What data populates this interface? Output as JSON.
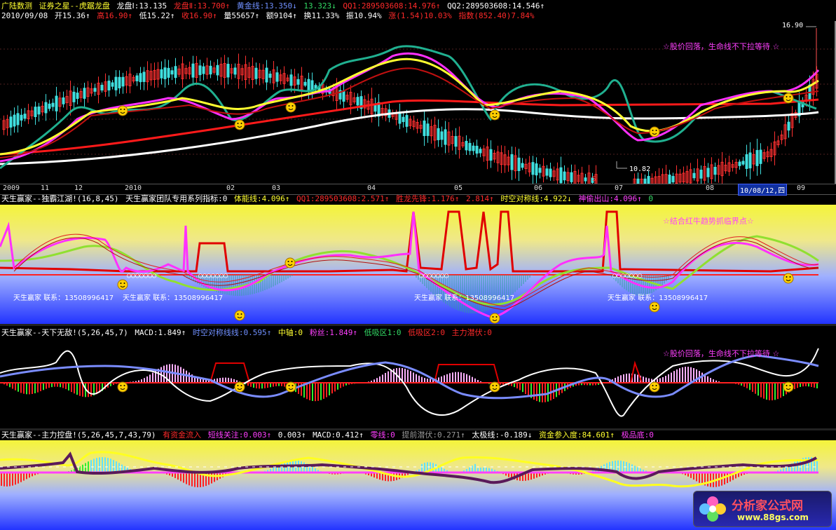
{
  "header1": [
    "广陆数测",
    "证券之星--虎踞龙盘",
    "龙盘Ⅰ:13.135",
    "龙盘Ⅱ:13.700↑",
    "黄金线:13.350↓",
    "13.323↓",
    "QQ1:289503608:14.976↑",
    "QQ2:289503608:14.546↑"
  ],
  "header2": [
    "2010/09/08",
    "开15.36↑",
    "高16.90↑",
    "低15.22↑",
    "收16.90↑",
    "量55657↑",
    "额9104↑",
    "换11.33%",
    "振10.94%",
    "涨(1.54)10.03%",
    "指数(852.40)7.84%"
  ],
  "main": {
    "high_label": "16.90",
    "low_label": "10.82",
    "s_mark": "S",
    "note": "☆股价回落，生命线不下拉等待 ☆"
  },
  "axis": {
    "labels": [
      "2009",
      "11",
      "12",
      "2010",
      "02",
      "03",
      "04",
      "05",
      "06",
      "07",
      "08",
      "09"
    ],
    "selected": "10/08/12,四"
  },
  "panel2": {
    "header": [
      "天生赢家--独霸江湖!(16,8,45)",
      "天生赢家团队专用系列指标:0",
      "体能线:4.096↑",
      "QQ1:289503608:2.571↑",
      "胜龙先锋:1.176↑",
      "2.814↑",
      "时空对称线:4.922↓",
      "神偷出山:4.096↑",
      "0"
    ],
    "note": "☆结合红牛趋势抓临界点☆",
    "contact_a": "天生赢家 联系：13508996417",
    "contact_b": "天生赢家 联系：13508996417",
    "contact_c": "天生赢家 联系：13508996417",
    "contact_d": "天生赢家 联系：13508996417",
    "circles": "○○○○○○○"
  },
  "panel3": {
    "header": [
      "天生赢家--天下无敌!(5,26,45,7)",
      "MACD:1.849↑",
      "时空对称线线:0.595↑",
      "中轴:0",
      "粉丝:1.849↑",
      "低吸区1:0",
      "低吸区2:0",
      "主力潜伏:0"
    ],
    "note": "☆股价回落，生命线不下拉等待 ☆"
  },
  "panel4": {
    "header": [
      "天生赢家--主力控盘!(5,26,45,7,43,79)",
      "有资金流入",
      "短线关注:0.003↑",
      "0.003↑",
      "MACD:0.412↑",
      "零线:0",
      "提前潜伏:0.271↑",
      "太极线:-0.189↓",
      "资金参入度:84.601↑",
      "极品底:0"
    ]
  },
  "logo": {
    "title": "分析家公式网",
    "url": "www.88gs.com"
  },
  "colors": {
    "red": "#ff2a2a",
    "yellow": "#ffff30",
    "magenta": "#ff40ff",
    "teal": "#20c0a0",
    "white": "#ffffff",
    "green": "#33dd66",
    "blue": "#7a8cff"
  }
}
